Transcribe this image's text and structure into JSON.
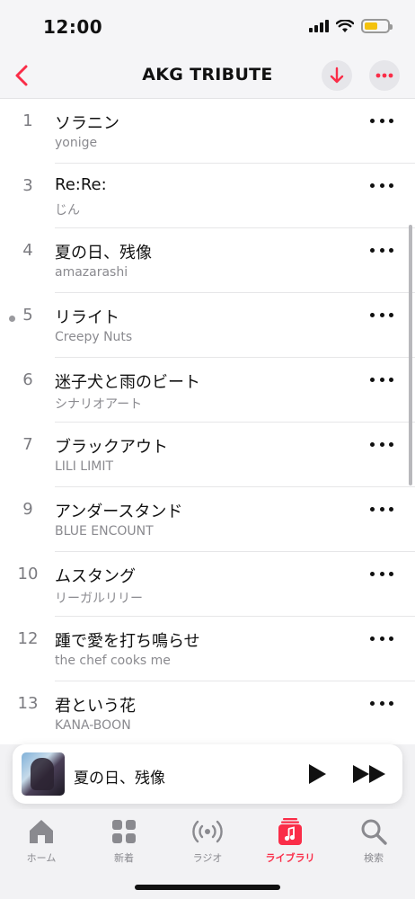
{
  "status_bar": {
    "time": "12:00"
  },
  "nav": {
    "title": "AKG TRIBUTE"
  },
  "colors": {
    "accent": "#fa2d48",
    "battery": "#f4c20d"
  },
  "tracks": [
    {
      "number": "1",
      "title": "ソラニン",
      "artist": "yonige"
    },
    {
      "number": "3",
      "title": "Re:Re:",
      "artist": "じん"
    },
    {
      "number": "4",
      "title": "夏の日、残像",
      "artist": "amazarashi"
    },
    {
      "number": "5",
      "title": "リライト",
      "artist": "Creepy Nuts"
    },
    {
      "number": "6",
      "title": "迷子犬と雨のビート",
      "artist": "シナリオアート"
    },
    {
      "number": "7",
      "title": "ブラックアウト",
      "artist": "LILI LIMIT"
    },
    {
      "number": "9",
      "title": "アンダースタンド",
      "artist": "BLUE ENCOUNT"
    },
    {
      "number": "10",
      "title": "ムスタング",
      "artist": "リーガルリリー"
    },
    {
      "number": "12",
      "title": "踵で愛を打ち鳴らせ",
      "artist": "the chef cooks me"
    },
    {
      "number": "13",
      "title": "君という花",
      "artist": "KANA-BOON"
    }
  ],
  "mini_player": {
    "title": "夏の日、残像"
  },
  "tabs": [
    {
      "label": "ホーム",
      "icon": "home-icon"
    },
    {
      "label": "新着",
      "icon": "grid-icon"
    },
    {
      "label": "ラジオ",
      "icon": "radio-icon"
    },
    {
      "label": "ライブラリ",
      "icon": "library-icon",
      "active": true
    },
    {
      "label": "検索",
      "icon": "search-icon"
    }
  ]
}
